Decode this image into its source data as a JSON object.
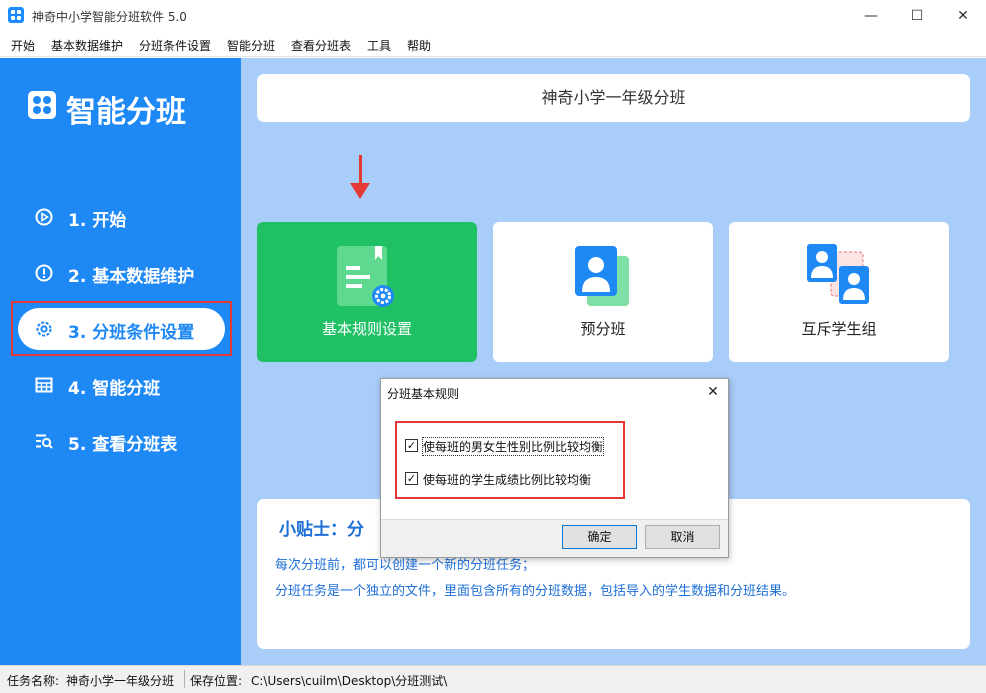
{
  "window": {
    "title": "神奇中小学智能分班软件 5.0",
    "minimize": "—",
    "maximize": "☐",
    "close": "✕"
  },
  "menu": [
    "开始",
    "基本数据维护",
    "分班条件设置",
    "智能分班",
    "查看分班表",
    "工具",
    "帮助"
  ],
  "sidebar": {
    "app_name": "智能分班",
    "items": [
      {
        "label": "1. 开始",
        "icon": "play-circle-icon"
      },
      {
        "label": "2. 基本数据维护",
        "icon": "info-circle-icon"
      },
      {
        "label": "3. 分班条件设置",
        "icon": "gear-icon",
        "active": true
      },
      {
        "label": "4. 智能分班",
        "icon": "table-grid-icon"
      },
      {
        "label": "5. 查看分班表",
        "icon": "list-search-icon"
      }
    ]
  },
  "main": {
    "task_title": "神奇小学一年级分班",
    "cards": [
      {
        "label": "基本规则设置",
        "icon": "rulebook-gear-icon"
      },
      {
        "label": "预分班",
        "icon": "student-cards-icon"
      },
      {
        "label": "互斥学生组",
        "icon": "exclusive-students-icon"
      }
    ],
    "tips": {
      "title": "小贴士：分",
      "lines": [
        "每次分班前，都可以创建一个新的分班任务；",
        "分班任务是一个独立的文件，里面包含所有的分班数据，包括导入的学生数据和分班结果。"
      ]
    }
  },
  "dialog": {
    "title": "分班基本规则",
    "close": "✕",
    "options": [
      {
        "label": "使每班的男女生性别比例比较均衡",
        "checked": true
      },
      {
        "label": "使每班的学生成绩比例比较均衡",
        "checked": true
      }
    ],
    "ok": "确定",
    "cancel": "取消"
  },
  "status": {
    "task_label": "任务名称:",
    "task_value": "神奇小学一年级分班",
    "path_label": "保存位置:",
    "path_value": "C:\\Users\\cuilm\\Desktop\\分班测试\\"
  },
  "colors": {
    "sidebar": "#1e88f5",
    "main_bg": "#a9cdf9",
    "green_card": "#20c164",
    "highlight": "#e53935",
    "tips_text": "#1e6fd8"
  }
}
